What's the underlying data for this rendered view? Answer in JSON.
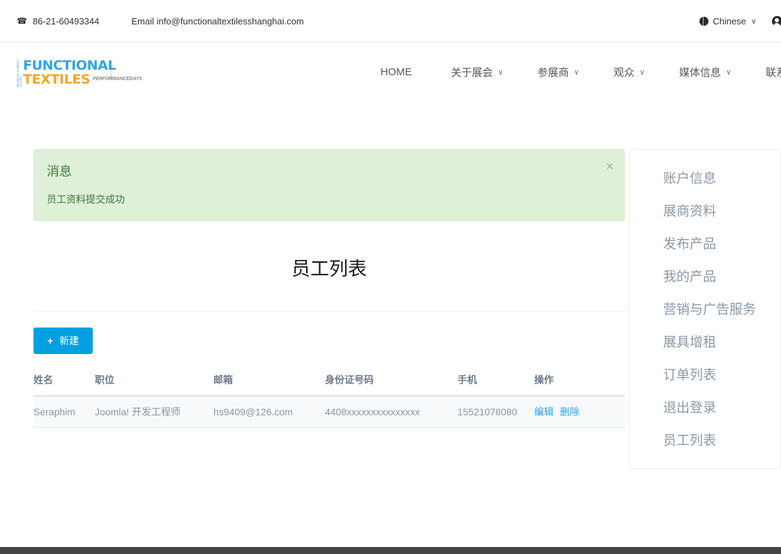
{
  "topbar": {
    "phone_icon": "phone-icon",
    "phone": "86-21-60493344",
    "email": "Email info@functionaltextilesshanghai.com",
    "language": "Chinese",
    "language_caret": "∨",
    "user": "我"
  },
  "logo": {
    "side_text": "MUNICH FABRIC START",
    "line1": "FUNCTIONAL",
    "line2": "TEXTILES",
    "tagline": "PERFORMANCEDAYS"
  },
  "nav": {
    "items": [
      {
        "label": "HOME",
        "caret": ""
      },
      {
        "label": "关于展会",
        "caret": "∨"
      },
      {
        "label": "参展商",
        "caret": "∨"
      },
      {
        "label": "观众",
        "caret": "∨"
      },
      {
        "label": "媒体信息",
        "caret": "∨"
      },
      {
        "label": "联系我",
        "caret": ""
      }
    ]
  },
  "alert": {
    "title": "消息",
    "message": "员工资料提交成功",
    "close_label": "×",
    "bg_color": "#dff0d8",
    "text_color": "#3c763d"
  },
  "main": {
    "page_title": "员工列表",
    "new_button": {
      "icon": "+",
      "label": "新建",
      "color": "#00a0e3"
    },
    "table": {
      "headers": [
        "姓名",
        "职位",
        "邮箱",
        "身份证号码",
        "手机",
        "操作"
      ],
      "rows": [
        {
          "name": "Seraphim",
          "position": "Joomla! 开发工程师",
          "email": "hs9409@126.com",
          "id_number": "4408xxxxxxxxxxxxxxx",
          "phone": "15521078080",
          "edit": "编辑",
          "delete": "删除"
        }
      ]
    }
  },
  "sidebar": {
    "items": [
      {
        "label": "账户信息"
      },
      {
        "label": "展商资料"
      },
      {
        "label": "发布产品"
      },
      {
        "label": "我的产品"
      },
      {
        "label": "营销与广告服务"
      },
      {
        "label": "展具增租"
      },
      {
        "label": "订单列表"
      },
      {
        "label": "退出登录"
      },
      {
        "label": "员工列表"
      }
    ]
  }
}
